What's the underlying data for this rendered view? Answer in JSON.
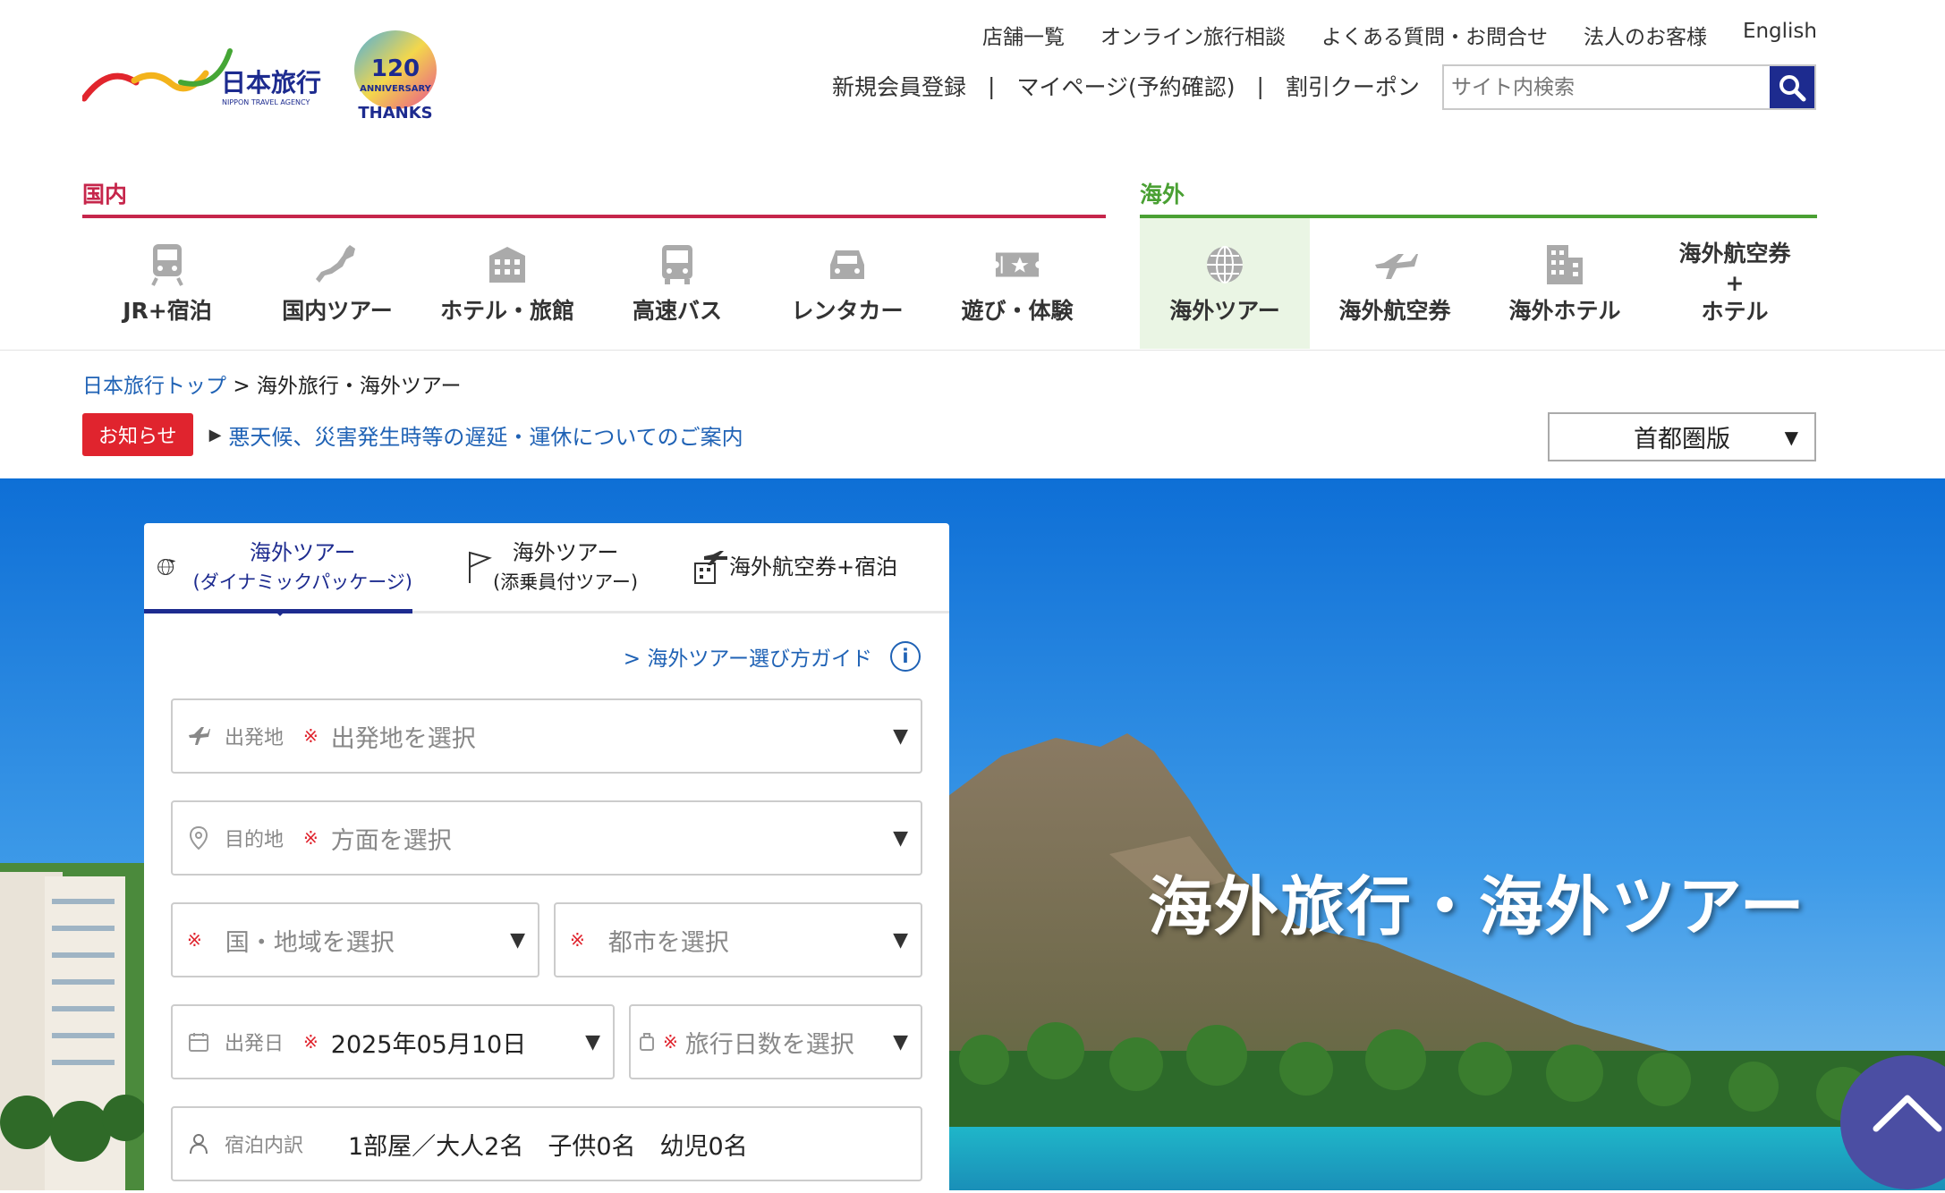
{
  "header": {
    "logo_text": "日本旅行",
    "logo_sub": "NIPPON TRAVEL AGENCY",
    "anniversary": {
      "number": "120",
      "label": "ANNIVERSARY",
      "thanks": "THANKS"
    },
    "util_links": [
      "店舗一覧",
      "オンライン旅行相談",
      "よくある質問・お問合せ",
      "法人のお客様",
      "English"
    ],
    "member_links": [
      "新規会員登録",
      "マイページ(予約確認)",
      "割引クーポン"
    ],
    "search_placeholder": "サイト内検索"
  },
  "nav": {
    "domestic_label": "国内",
    "overseas_label": "海外",
    "domestic_color": "#c6264b",
    "overseas_color": "#4aa033",
    "domestic_items": [
      {
        "label": "JR+宿泊",
        "icon": "train-icon"
      },
      {
        "label": "国内ツアー",
        "icon": "japan-map-icon"
      },
      {
        "label": "ホテル・旅館",
        "icon": "hotel-icon"
      },
      {
        "label": "高速バス",
        "icon": "bus-icon"
      },
      {
        "label": "レンタカー",
        "icon": "car-icon"
      },
      {
        "label": "遊び・体験",
        "icon": "ticket-icon"
      }
    ],
    "overseas_items": [
      {
        "label": "海外ツアー",
        "icon": "globe-icon",
        "active": true
      },
      {
        "label": "海外航空券",
        "icon": "airplane-icon"
      },
      {
        "label": "海外ホテル",
        "icon": "building-icon"
      },
      {
        "label": "海外航空券\n+\nホテル",
        "icon": ""
      }
    ]
  },
  "breadcrumb": {
    "home": "日本旅行トップ",
    "sep": ">",
    "current": "海外旅行・海外ツアー"
  },
  "notice": {
    "badge": "お知らせ",
    "text": "悪天候、災害発生時等の遅延・運休についてのご案内"
  },
  "region_select": "首都圏版",
  "hero": {
    "title": "海外旅行・海外ツアー"
  },
  "search_panel": {
    "tabs": [
      {
        "title": "海外ツアー",
        "sub": "(ダイナミックパッケージ)",
        "active": true
      },
      {
        "title": "海外ツアー",
        "sub": "(添乗員付ツアー)"
      },
      {
        "title": "海外航空券+宿泊",
        "sub": ""
      }
    ],
    "guide_link": "> 海外ツアー選び方ガイド",
    "required_mark": "※",
    "departure": {
      "label": "出発地",
      "placeholder": "出発地を選択"
    },
    "destination": {
      "label": "目的地",
      "placeholder": "方面を選択"
    },
    "country": {
      "placeholder": "国・地域を選択"
    },
    "city": {
      "placeholder": "都市を選択"
    },
    "date": {
      "label": "出発日",
      "value": "2025年05月10日"
    },
    "days": {
      "placeholder": "旅行日数を選択"
    },
    "rooms": {
      "label": "宿泊内訳",
      "value": "1部屋／大人2名　子供0名　幼児0名"
    }
  }
}
